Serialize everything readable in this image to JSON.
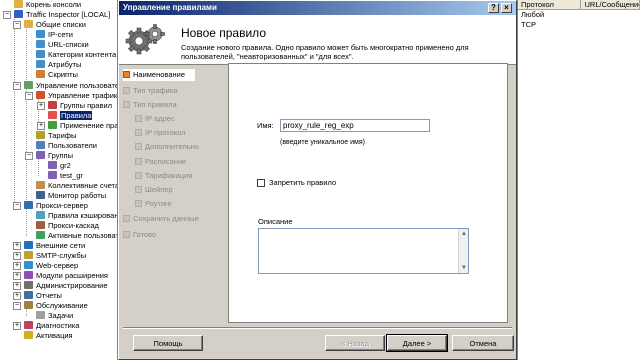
{
  "tree": {
    "items": [
      {
        "label": "Корень консоли",
        "icon": "folder-icon"
      },
      {
        "label": "Traffic Inspector [LOCAL]",
        "icon": "server-icon"
      },
      {
        "label": "Общие списки",
        "icon": "folder-icon"
      },
      {
        "label": "IP-сети",
        "icon": "list-icon"
      },
      {
        "label": "URL-списки",
        "icon": "list-icon"
      },
      {
        "label": "Категории контента",
        "icon": "list-icon"
      },
      {
        "label": "Атрибуты",
        "icon": "list-icon"
      },
      {
        "label": "Скрипты",
        "icon": "script-icon"
      },
      {
        "label": "Управление пользователями",
        "icon": "users-icon"
      },
      {
        "label": "Управление трафиком",
        "icon": "traffic-icon"
      },
      {
        "label": "Группы правил",
        "icon": "rules-group-icon"
      },
      {
        "label": "Правила",
        "icon": "rules-icon"
      },
      {
        "label": "Применение правил",
        "icon": "apply-rules-icon"
      },
      {
        "label": "Тарифы",
        "icon": "tariff-icon"
      },
      {
        "label": "Пользователи",
        "icon": "user-icon"
      },
      {
        "label": "Группы",
        "icon": "group-icon"
      },
      {
        "label": "gr2",
        "icon": "group-icon"
      },
      {
        "label": "test_gr",
        "icon": "group-icon"
      },
      {
        "label": "Коллективные счета",
        "icon": "account-icon"
      },
      {
        "label": "Монитор работы",
        "icon": "monitor-icon"
      },
      {
        "label": "Прокси-сервер",
        "icon": "proxy-icon"
      },
      {
        "label": "Правила кэширования",
        "icon": "cache-icon"
      },
      {
        "label": "Прокси-каскад",
        "icon": "cascade-icon"
      },
      {
        "label": "Активные пользователи",
        "icon": "active-users-icon"
      },
      {
        "label": "Внешние сети",
        "icon": "network-icon"
      },
      {
        "label": "SMTP-службы",
        "icon": "mail-icon"
      },
      {
        "label": "Web-сервер",
        "icon": "web-icon"
      },
      {
        "label": "Модули расширения",
        "icon": "plugin-icon"
      },
      {
        "label": "Администрирование",
        "icon": "admin-icon"
      },
      {
        "label": "Отчеты",
        "icon": "report-icon"
      },
      {
        "label": "Обслуживание",
        "icon": "service-icon"
      },
      {
        "label": "Задачи",
        "icon": "task-icon"
      },
      {
        "label": "Диагностика",
        "icon": "diagnostics-icon"
      },
      {
        "label": "Активация",
        "icon": "key-icon"
      }
    ]
  },
  "rightlist": {
    "columns": [
      "Протокол",
      "URL/Сообщение"
    ],
    "rows": [
      "Любой",
      "TCP"
    ]
  },
  "dialog": {
    "title": "Управление правилами",
    "buttons": {
      "help": "?",
      "close": "×"
    },
    "header_title": "Новое правило",
    "header_desc": "Создание нового правила. Одно правило может быть многократно применено для пользователей, \"неавторизованных\" и \"для всех\".",
    "steps": [
      {
        "label": "Наименование",
        "active": true
      },
      {
        "label": "Тип трафика"
      },
      {
        "label": "Тип правила"
      },
      {
        "label": "IP адрес"
      },
      {
        "label": "IP протокол"
      },
      {
        "label": "Дополнительно"
      },
      {
        "label": "Расписание"
      },
      {
        "label": "Тарификация"
      },
      {
        "label": "Шейпер"
      },
      {
        "label": "Роутинг"
      },
      {
        "label": "Сохранить данные"
      },
      {
        "label": "Готово"
      }
    ],
    "form": {
      "name_label": "Имя:",
      "name_value": "proxy_rule_reg_exp",
      "name_hint": "(введите уникальное имя)",
      "disable_label": "Запретить правило",
      "disable_checked": false,
      "desc_label": "Описание",
      "desc_value": ""
    },
    "footer": {
      "help": "Помощь",
      "back": "< Назад",
      "next": "Далее >",
      "cancel": "Отмена"
    }
  },
  "colors": {
    "titlebar_start": "#0a246a",
    "titlebar_end": "#a6caf0",
    "active_step": "#f08020",
    "selection": "#0a246a"
  }
}
